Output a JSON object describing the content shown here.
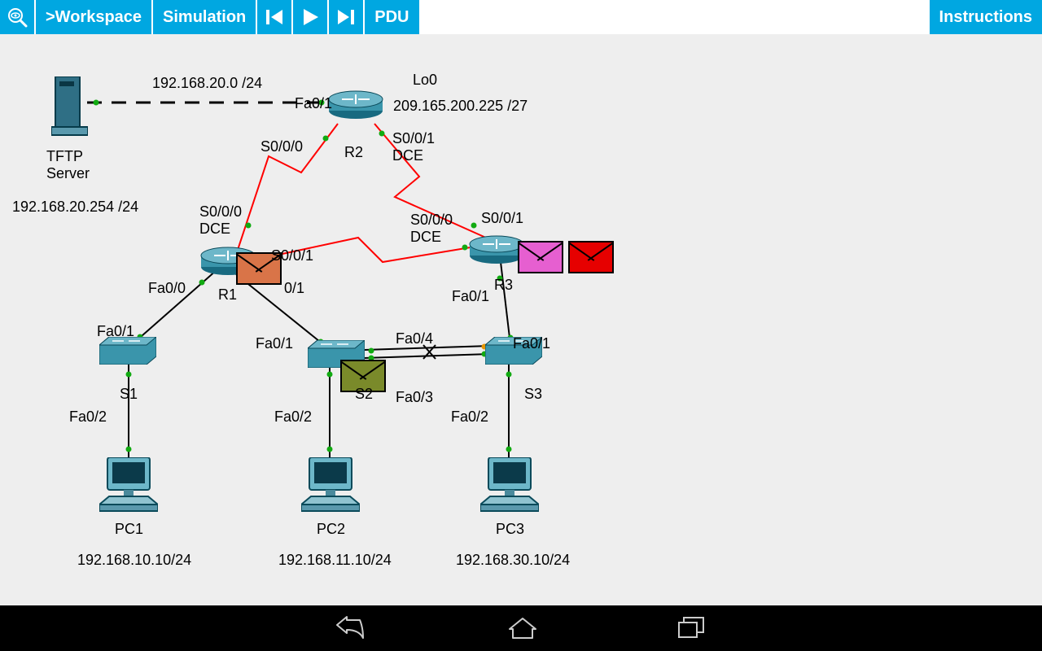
{
  "toolbar": {
    "workspace": ">Workspace",
    "simulation": "Simulation",
    "pdu": "PDU",
    "instructions": "Instructions"
  },
  "nodes": {
    "tftp": {
      "name": "TFTP\nServer",
      "ip": "192.168.20.254 /24"
    },
    "r1": {
      "name": "R1"
    },
    "r2": {
      "name": "R2",
      "lo_name": "Lo0",
      "lo_ip": "209.165.200.225 /27"
    },
    "r3": {
      "name": "R3"
    },
    "s1": {
      "name": "S1"
    },
    "s2": {
      "name": "S2"
    },
    "s3": {
      "name": "S3"
    },
    "pc1": {
      "name": "PC1",
      "ip": "192.168.10.10/24"
    },
    "pc2": {
      "name": "PC2",
      "ip": "192.168.11.10/24"
    },
    "pc3": {
      "name": "PC3",
      "ip": "192.168.30.10/24"
    }
  },
  "links": {
    "tftp_r2_net": "192.168.20.0 /24",
    "r2_fa01": "Fa0/1",
    "r2_s000": "S0/0/0",
    "r2_s001_dce": "S0/0/1\nDCE",
    "r1_s000_dce": "S0/0/0\nDCE",
    "r1_s001": "S0/0/1",
    "r1_fa00": "Fa0/0",
    "r1_fa01_lower": "0/1",
    "r3_s000_dce": "S0/0/0\nDCE",
    "r3_s001": "S0/0/1",
    "r3_fa01": "Fa0/1",
    "s1_fa01": "Fa0/1",
    "s1_fa02": "Fa0/2",
    "s2_fa01": "Fa0/1",
    "s2_fa02": "Fa0/2",
    "s2_fa04": "Fa0/4",
    "s2_fa03": "Fa0/3",
    "s3_fa01": "Fa0/1",
    "s3_fa02": "Fa0/2"
  },
  "pdus": {
    "r1": "#d97448",
    "r3a": "#e65fd0",
    "r3b": "#e60000",
    "s2": "#7a8a2a"
  }
}
